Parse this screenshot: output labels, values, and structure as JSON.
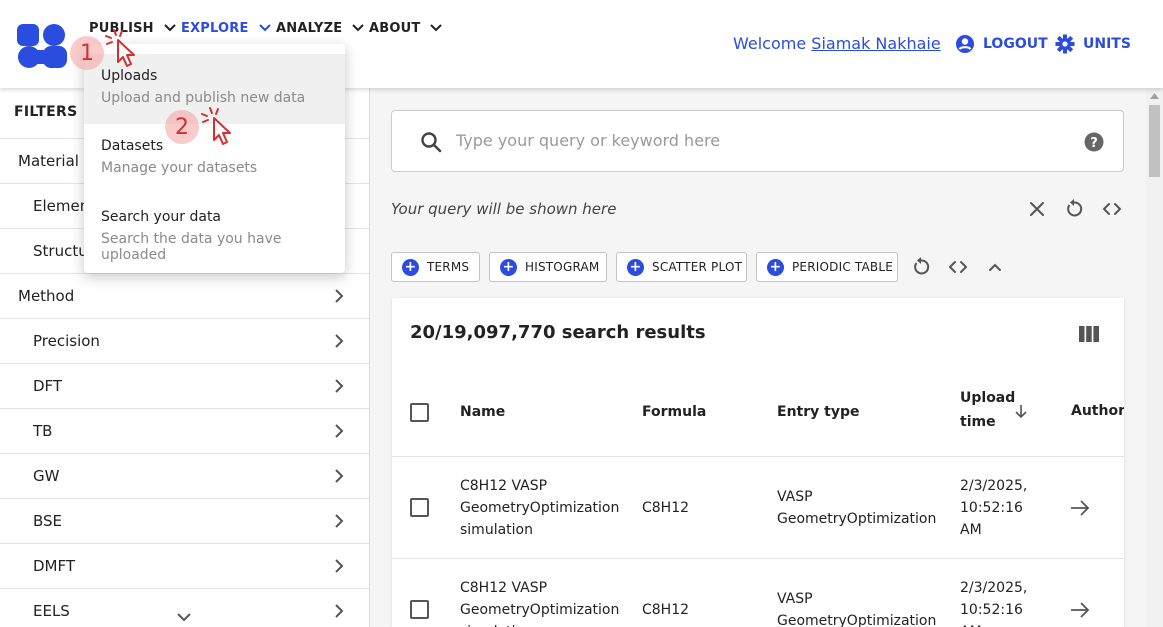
{
  "header": {
    "nav": [
      {
        "label": "PUBLISH"
      },
      {
        "label": "EXPLORE"
      },
      {
        "label": "ANALYZE"
      },
      {
        "label": "ABOUT"
      }
    ],
    "welcome_prefix": "Welcome",
    "user_name": "Siamak Nakhaie",
    "logout_label": "LOGOUT",
    "units_label": "UNITS",
    "accent_color": "#2a4cdf"
  },
  "dropdown": {
    "items": [
      {
        "title": "Uploads",
        "subtitle": "Upload and publish new data"
      },
      {
        "title": "Datasets",
        "subtitle": "Manage your datasets"
      },
      {
        "title": "Search your data",
        "subtitle": "Search the data you have uploaded"
      }
    ]
  },
  "annotations": {
    "step1": "1",
    "step2": "2"
  },
  "sidebar": {
    "title": "FILTERS",
    "items": [
      {
        "label": "Material",
        "indent": false
      },
      {
        "label": "Elements",
        "indent": true
      },
      {
        "label": "Structure",
        "indent": true
      },
      {
        "label": "Method",
        "indent": false
      },
      {
        "label": "Precision",
        "indent": true
      },
      {
        "label": "DFT",
        "indent": true
      },
      {
        "label": "TB",
        "indent": true
      },
      {
        "label": "GW",
        "indent": true
      },
      {
        "label": "BSE",
        "indent": true
      },
      {
        "label": "DMFT",
        "indent": true
      },
      {
        "label": "EELS",
        "indent": true
      }
    ]
  },
  "search": {
    "placeholder": "Type your query or keyword here",
    "value": ""
  },
  "query_display": "Your query will be shown here",
  "widgets": [
    {
      "label": "TERMS"
    },
    {
      "label": "HISTOGRAM"
    },
    {
      "label": "SCATTER PLOT"
    },
    {
      "label": "PERIODIC TABLE"
    }
  ],
  "results": {
    "title": "20/19,097,770 search results",
    "columns": [
      "Name",
      "Formula",
      "Entry type",
      "Upload",
      "time",
      "Authors"
    ],
    "rows": [
      {
        "name": [
          "C8H12 VASP",
          "GeometryOptimization",
          "simulation"
        ],
        "formula": "C8H12",
        "entry_type": [
          "VASP",
          "GeometryOptimization"
        ],
        "upload_time": [
          "2/3/2025,",
          "10:52:16",
          "AM"
        ]
      },
      {
        "name": [
          "C8H12 VASP",
          "GeometryOptimization",
          "simulation"
        ],
        "formula": "C8H12",
        "entry_type": [
          "VASP",
          "GeometryOptimization"
        ],
        "upload_time": [
          "2/3/2025,",
          "10:52:16",
          "AM"
        ]
      }
    ]
  }
}
